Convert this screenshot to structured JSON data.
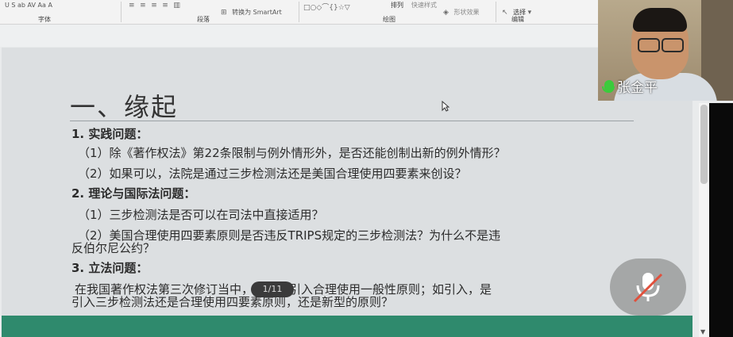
{
  "ribbon": {
    "font_group": "字体",
    "paragraph_group": "段落",
    "drawing_group": "绘图",
    "editing_group": "编辑",
    "convert_smartart": "转换为 SmartArt",
    "arrange": "排列",
    "quick_styles": "快速样式",
    "shape_effects": "形状效果",
    "select": "选择",
    "font_tools": "U S ab AV Aa A"
  },
  "slide": {
    "title": "一、缘起",
    "lines": [
      "1. 实践问题：",
      "（1）除《著作权法》第22条限制与例外情形外，是否还能创制出新的例外情形？",
      "（2）如果可以，法院是通过三步检测法还是美国合理使用四要素来创设？",
      "2. 理论与国际法问题：",
      "（1）三步检测法是否可以在司法中直接适用？",
      "（2）美国合理使用四要素原则是否违反TRIPS规定的三步检测法？为什么不是违",
      "反伯尔尼公约？",
      "3. 立法问题：",
      "在我国著作权法第三次修订当中，是否要引入合理使用一般性原则；如引入，是",
      "引入三步检测法还是合理使用四要素原则，还是新型的原则？"
    ]
  },
  "pager": "1/11",
  "participant": {
    "name": "张金平"
  },
  "colors": {
    "footer": "#2f8a6d",
    "mic_active": "#3ccb3c",
    "mute_slash": "#e0503c"
  }
}
